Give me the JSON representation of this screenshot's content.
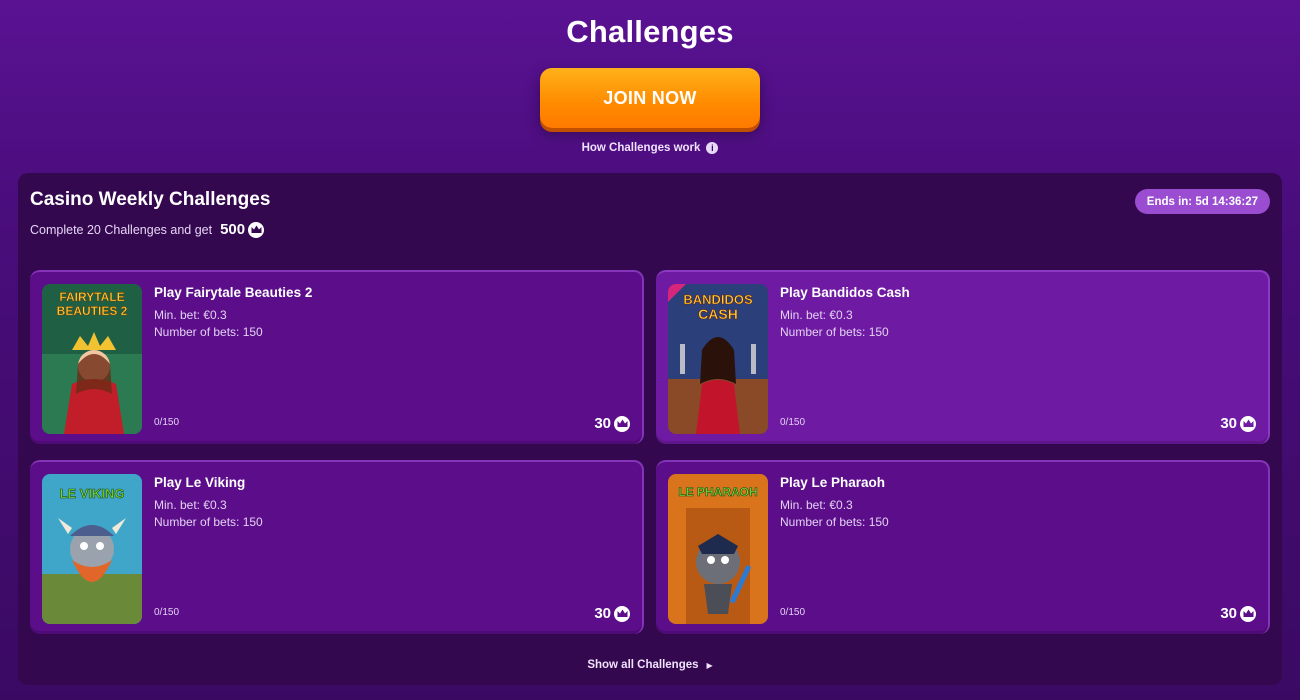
{
  "header": {
    "title": "Challenges",
    "join_label": "JOIN NOW",
    "how_label": "How Challenges work"
  },
  "panel": {
    "title": "Casino Weekly Challenges",
    "subtitle": "Complete 20 Challenges and get",
    "reward_total": "500",
    "ends_label": "Ends in: 5d 14:36:27",
    "show_all_label": "Show all Challenges"
  },
  "challenges": [
    {
      "title": "Play Fairytale Beauties 2",
      "min_bet": "Min. bet: €0.3",
      "num_bets": "Number of bets: 150",
      "progress": "0/150",
      "reward": "30",
      "thumb_text_1": "FAIRYTALE",
      "thumb_text_2": "BEAUTIES 2",
      "thumb_bg": "#1f5f43"
    },
    {
      "title": "Play Bandidos Cash",
      "min_bet": "Min. bet: €0.3",
      "num_bets": "Number of bets: 150",
      "progress": "0/150",
      "reward": "30",
      "thumb_text_1": "BANDIDOS",
      "thumb_text_2": "CASH",
      "thumb_bg": "#2b3f7a"
    },
    {
      "title": "Play Le Viking",
      "min_bet": "Min. bet: €0.3",
      "num_bets": "Number of bets: 150",
      "progress": "0/150",
      "reward": "30",
      "thumb_text_1": "LE VIKING",
      "thumb_text_2": "",
      "thumb_bg": "#3fa6c9"
    },
    {
      "title": "Play Le Pharaoh",
      "min_bet": "Min. bet: €0.3",
      "num_bets": "Number of bets: 150",
      "progress": "0/150",
      "reward": "30",
      "thumb_text_1": "LE PHARAOH",
      "thumb_text_2": "",
      "thumb_bg": "#d9741c"
    }
  ],
  "colors": {
    "accent_orange": "#ff8a00",
    "panel_bg": "#34084f",
    "card_bg": "#5c0e8a",
    "badge_bg": "#9a4dd1"
  }
}
